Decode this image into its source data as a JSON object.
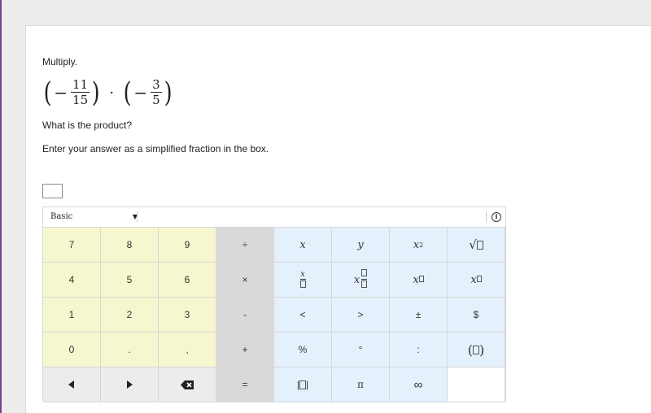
{
  "problem": {
    "instruction": "Multiply.",
    "expression": {
      "open_paren": "(",
      "close_paren": ")",
      "minus": "−",
      "dot": "·",
      "fraction1": {
        "numerator": "11",
        "denominator": "15"
      },
      "fraction2": {
        "numerator": "3",
        "denominator": "5"
      }
    },
    "question": "What is the product?",
    "hint": "Enter your answer as a simplified fraction in the box.",
    "answer_value": ""
  },
  "keypad": {
    "mode": "Basic",
    "keys": {
      "seven": "7",
      "eight": "8",
      "nine": "9",
      "divide": "÷",
      "x": "x",
      "y": "y",
      "x_squared_base": "x",
      "x_squared_exp": "2",
      "sqrt_symbol": "√",
      "four": "4",
      "five": "5",
      "six": "6",
      "multiply": "×",
      "x_over_box_num": "x",
      "x_times_frac_x": "x",
      "x_power_base": "x",
      "x_sub_base": "x",
      "one": "1",
      "two": "2",
      "three": "3",
      "minus": "-",
      "less_than": "<",
      "greater_than": ">",
      "plus_minus": "±",
      "dollar": "$",
      "zero": "0",
      "decimal": ".",
      "comma": ",",
      "plus": "+",
      "percent": "%",
      "degree": "°",
      "colon": ":",
      "paren_open": "(",
      "paren_close": ")",
      "equals": "=",
      "abs_bar": "|",
      "pi": "π",
      "infinity": "∞"
    }
  }
}
